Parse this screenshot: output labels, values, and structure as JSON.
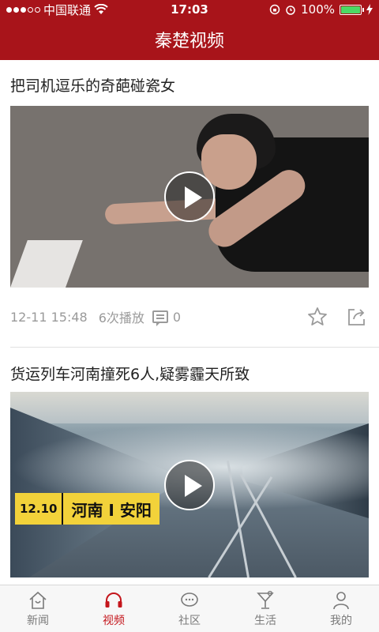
{
  "status_bar": {
    "carrier": "中国联通",
    "time": "17:03",
    "battery_percent": "100%",
    "battery_level": 1.0,
    "icons": [
      "signal-dots",
      "wifi-icon",
      "orientation-lock-icon",
      "alarm-icon",
      "battery-icon",
      "charging-icon"
    ]
  },
  "header": {
    "title": "秦楚视频"
  },
  "videos": [
    {
      "title": "把司机逗乐的奇葩碰瓷女",
      "time": "12-11 15:48",
      "views": "6次播放",
      "comments": "0"
    },
    {
      "title": "货运列车河南撞死6人,疑雾霾天所致",
      "overlay_date": "12.10",
      "overlay_place": "河南 I 安阳"
    }
  ],
  "tabs": [
    {
      "label": "新闻",
      "icon": "home-icon",
      "active": false
    },
    {
      "label": "视频",
      "icon": "headphones-icon",
      "active": true
    },
    {
      "label": "社区",
      "icon": "chat-bubble-icon",
      "active": false
    },
    {
      "label": "生活",
      "icon": "cocktail-icon",
      "active": false
    },
    {
      "label": "我的",
      "icon": "person-icon",
      "active": false
    }
  ],
  "colors": {
    "brand_red": "#a8141a",
    "active_tab": "#c4161c",
    "meta_gray": "#9a9a9a"
  }
}
